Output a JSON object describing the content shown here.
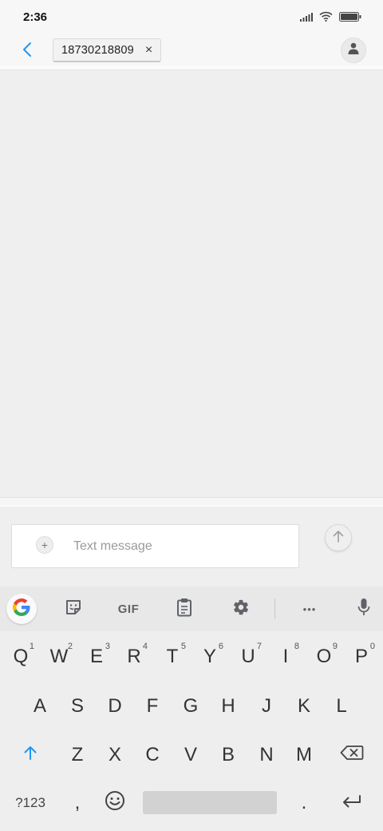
{
  "status_bar": {
    "time": "2:36"
  },
  "header": {
    "recipient": "18730218809",
    "remove_symbol": "×"
  },
  "compose": {
    "attach_symbol": "+",
    "placeholder": "Text message"
  },
  "keyboard_toolbar": {
    "gif_label": "GIF",
    "more_symbol": "•••"
  },
  "keyboard": {
    "row1": [
      {
        "label": "Q",
        "hint": "1"
      },
      {
        "label": "W",
        "hint": "2"
      },
      {
        "label": "E",
        "hint": "3"
      },
      {
        "label": "R",
        "hint": "4"
      },
      {
        "label": "T",
        "hint": "5"
      },
      {
        "label": "Y",
        "hint": "6"
      },
      {
        "label": "U",
        "hint": "7"
      },
      {
        "label": "I",
        "hint": "8"
      },
      {
        "label": "O",
        "hint": "9"
      },
      {
        "label": "P",
        "hint": "0"
      }
    ],
    "row2": [
      "A",
      "S",
      "D",
      "F",
      "G",
      "H",
      "J",
      "K",
      "L"
    ],
    "row3": [
      "Z",
      "X",
      "C",
      "V",
      "B",
      "N",
      "M"
    ],
    "symbols_label": "?123",
    "comma": ",",
    "period": "."
  },
  "colors": {
    "accent_blue": "#2196f3",
    "google_blue": "#4285f4",
    "google_red": "#ea4335",
    "google_yellow": "#fbbc05",
    "google_green": "#34a853"
  }
}
